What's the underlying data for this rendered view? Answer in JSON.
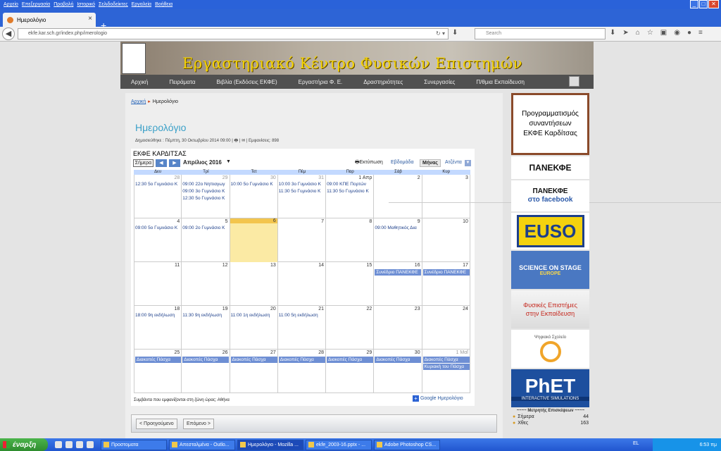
{
  "browser": {
    "menu": [
      "Αρχείο",
      "Επεξεργασία",
      "Προβολή",
      "Ιστορικό",
      "Σελιδοδείκτες",
      "Εργαλεία",
      "Βοήθεια"
    ],
    "tab_title": "Ημερολόγιο",
    "url": "ekfe.kar.sch.gr/index.php/imerologio",
    "search_placeholder": "Search"
  },
  "site": {
    "banner_title": "Εργαστηριακό Κέντρο Φυσικών Επιστημών",
    "nav": [
      "Αρχική",
      "Πειράματα",
      "Βιβλία (Εκδόσεις ΕΚΦΕ)",
      "Εργαστήρια Φ. Ε.",
      "Δραστηριότητες",
      "Συνεργασίες",
      "Π/θμια Εκπαίδευση"
    ]
  },
  "breadcrumb": {
    "home": "Αρχική",
    "current": "Ημερολόγιο"
  },
  "article": {
    "title": "Ημερολόγιο",
    "meta": "Δημοσιεύθηκε : Πέμπτη, 30 Οκτωβρίου 2014 09:00 | 🖶 | ✉ | Εμφανίσεις: 898"
  },
  "calendar": {
    "title": "ΕΚΦΕ ΚΑΡΔΙΤΣΑΣ",
    "today_btn": "Σήμερα",
    "month_label": "Απρίλιος 2016",
    "print_label": "Εκτύπωση",
    "views": {
      "week": "Εβδομάδα",
      "month": "Μήνας",
      "agenda": "Ατζέντα"
    },
    "day_headers": [
      "Δευ",
      "Τρί",
      "Τετ",
      "Πέμ",
      "Παρ",
      "Σάβ",
      "Κυρ"
    ],
    "weeks": [
      {
        "days": [
          {
            "n": "28",
            "other": true,
            "events": [
              "12:30 5ο Γυμνάσιο Κ"
            ]
          },
          {
            "n": "29",
            "other": true,
            "events": [
              "09:00 22ο Νηπιαγωγ",
              "09:00 3ο Γυμνάσιο Κ",
              "12:30 5ο Γυμνάσιο Κ"
            ]
          },
          {
            "n": "30",
            "other": true,
            "events": [
              "10:00 5ο Γυμνάσιο Κ"
            ]
          },
          {
            "n": "31",
            "other": true,
            "events": [
              "10:00 3ο Γυμνάσιο Κ",
              "11:30 5ο Γυμνάσιο Κ"
            ]
          },
          {
            "n": "1 Απρ",
            "events": [
              "09:00 ΚΠΕ Πορτών",
              "11:30 5ο Γυμνάσιο Κ"
            ]
          },
          {
            "n": "2",
            "events": []
          },
          {
            "n": "3",
            "events": []
          }
        ]
      },
      {
        "days": [
          {
            "n": "4",
            "events": [
              "09:00 5ο Γυμνάσιο Κ"
            ]
          },
          {
            "n": "5",
            "events": [
              "09:00 2ο Γυμνάσιο Κ"
            ]
          },
          {
            "n": "6",
            "today": true,
            "events": []
          },
          {
            "n": "7",
            "events": []
          },
          {
            "n": "8",
            "events": []
          },
          {
            "n": "9",
            "events": [
              "09:00 Μαθητικός Δια"
            ]
          },
          {
            "n": "10",
            "events": []
          }
        ]
      },
      {
        "days": [
          {
            "n": "11",
            "events": []
          },
          {
            "n": "12",
            "events": []
          },
          {
            "n": "13",
            "events": []
          },
          {
            "n": "14",
            "events": []
          },
          {
            "n": "15",
            "events": []
          },
          {
            "n": "16",
            "bars": [
              "Συνέδριο ΠΑΝΕΚΦΕ"
            ],
            "events": []
          },
          {
            "n": "17",
            "bars": [
              "Συνέδριο ΠΑΝΕΚΦΕ"
            ],
            "events": []
          }
        ]
      },
      {
        "days": [
          {
            "n": "18",
            "events": [
              "18:00 9η εκδήλωση"
            ]
          },
          {
            "n": "19",
            "events": [
              "11:30 9η εκδήλωση"
            ]
          },
          {
            "n": "20",
            "events": [
              "11:00 1η εκδήλωση"
            ]
          },
          {
            "n": "21",
            "events": [
              "11:00 5η εκδήλωση"
            ]
          },
          {
            "n": "22",
            "events": []
          },
          {
            "n": "23",
            "events": []
          },
          {
            "n": "24",
            "events": []
          }
        ]
      },
      {
        "days": [
          {
            "n": "25",
            "bars": [
              "Διακοπές Πάσχα"
            ],
            "events": []
          },
          {
            "n": "26",
            "bars": [
              "Διακοπές Πάσχα"
            ],
            "events": []
          },
          {
            "n": "27",
            "bars": [
              "Διακοπές Πάσχα"
            ],
            "events": []
          },
          {
            "n": "28",
            "bars": [
              "Διακοπές Πάσχα"
            ],
            "events": []
          },
          {
            "n": "29",
            "bars": [
              "Διακοπές Πάσχα"
            ],
            "events": []
          },
          {
            "n": "30",
            "bars": [
              "Διακοπές Πάσχα"
            ],
            "events": []
          },
          {
            "n": "1 Μαΐ",
            "other": true,
            "bars": [
              "Διακοπές Πάσχα",
              "Κυριακή του Πάσχα"
            ],
            "events": []
          }
        ]
      }
    ],
    "timezone_note": "Συμβάντα που εμφανίζονται στη ζώνη ώρας: Αθήνα",
    "google_badge": "Google Ημερολόγιο"
  },
  "pager": {
    "prev": "< Προηγούμενο",
    "next": "Επόμενο >"
  },
  "sidebar": {
    "programming": [
      "Προγραμματισμός",
      "συναντήσεων",
      "ΕΚΦΕ Καρδίτσας"
    ],
    "panekfe": "ΠΑΝΕΚΦΕ",
    "panekfe_fb_1": "ΠΑΝΕΚΦΕ",
    "panekfe_fb_2": "στο facebook",
    "euso": "EUSO",
    "science_on_stage": "SCIENCE ON STAGE",
    "europe": "EUROPE",
    "physics_edu": [
      "Φυσικές Επιστήμες",
      "στην Εκπαίδευση"
    ],
    "digital_school": "Ψηφιακό Σχολείο",
    "phet": "PhET",
    "phet_sub": "INTERACTIVE SIMULATIONS"
  },
  "counter": {
    "heading": "~~~~ Μετρητής Επισκέψεων ~~~~",
    "rows": [
      {
        "label": "Σήμερα",
        "value": "44"
      },
      {
        "label": "Χθες",
        "value": "163"
      }
    ]
  },
  "taskbar": {
    "start": "έναρξη",
    "tasks": [
      "Προστοματα",
      "Απεσταλμένα - Outlo...",
      "Ημερολόγιο - Mozilla ...",
      "ekfe_2003-16.pptx - ...",
      "Adobe Photoshop CS..."
    ],
    "lang": "EL",
    "clock": "6:53 πμ"
  }
}
